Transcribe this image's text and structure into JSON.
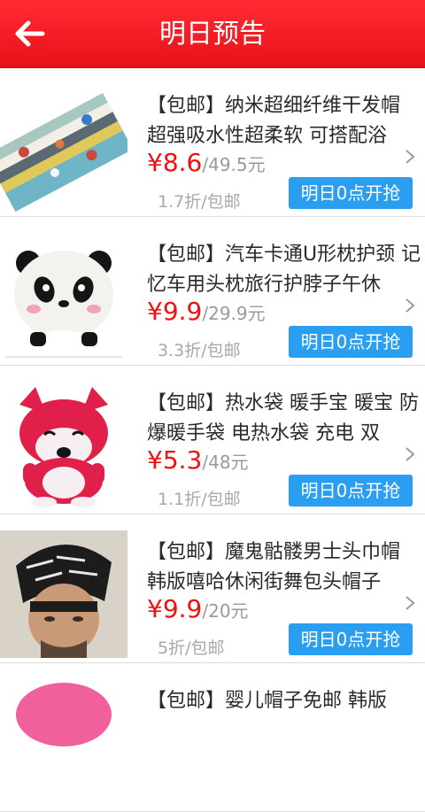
{
  "header": {
    "title": "明日预告",
    "back_icon": "back-arrow-icon"
  },
  "colors": {
    "header_red": "#ee1c22",
    "price_red": "#ee1111",
    "button_blue": "#2a9ef0"
  },
  "items": [
    {
      "name": "【包邮】纳米超细纤维干发帽 超强吸水性超柔软 可搭配浴",
      "currency": "¥",
      "price": "8.6",
      "original": "/49.5元",
      "discount": "1.7折/包邮",
      "button": "明日0点开抢"
    },
    {
      "name": "【包邮】汽车卡通U形枕护颈 记忆车用头枕旅行护脖子午休",
      "currency": "¥",
      "price": "9.9",
      "original": "/29.9元",
      "discount": "3.3折/包邮",
      "button": "明日0点开抢"
    },
    {
      "name": "【包邮】热水袋 暖手宝 暖宝 防爆暖手袋 电热水袋 充电 双",
      "currency": "¥",
      "price": "5.3",
      "original": "/48元",
      "discount": "1.1折/包邮",
      "button": "明日0点开抢"
    },
    {
      "name": "【包邮】魔鬼骷髅男士头巾帽 韩版嘻哈休闲街舞包头帽子",
      "currency": "¥",
      "price": "9.9",
      "original": "/20元",
      "discount": "5折/包邮",
      "button": "明日0点开抢"
    },
    {
      "name": "【包邮】婴儿帽子免邮 韩版",
      "currency": "",
      "price": "",
      "original": "",
      "discount": "",
      "button": ""
    }
  ]
}
